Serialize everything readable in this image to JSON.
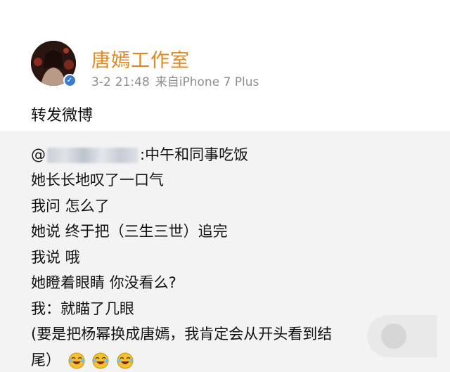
{
  "post": {
    "author_name": "唐嫣工作室",
    "date": "3-2",
    "time": "21:48",
    "source": "来自iPhone 7 Plus",
    "repost_text": "转发微博"
  },
  "quoted": {
    "mention_prefix": "@",
    "mention_suffix": ":中午和同事吃饭",
    "lines": [
      "她长长地叹了一口气",
      "我问 怎么了",
      "她说 终于把（三生三世）追完",
      "我说 哦",
      "她瞪着眼睛 你没看么?",
      "我：就瞄了几眼",
      "(要是把杨幂换成唐嫣，我肯定会从开头看到结",
      "尾）"
    ]
  },
  "icons": {
    "avatar": "avatar",
    "verified": "verified-badge-icon",
    "emoji": "laughing-crying-emoji-icon"
  },
  "colors": {
    "author_name": "#e0861d",
    "meta": "#8e8e8e",
    "quoted_background": "#f3f3f3",
    "verified_badge": "#3b7ccf"
  }
}
